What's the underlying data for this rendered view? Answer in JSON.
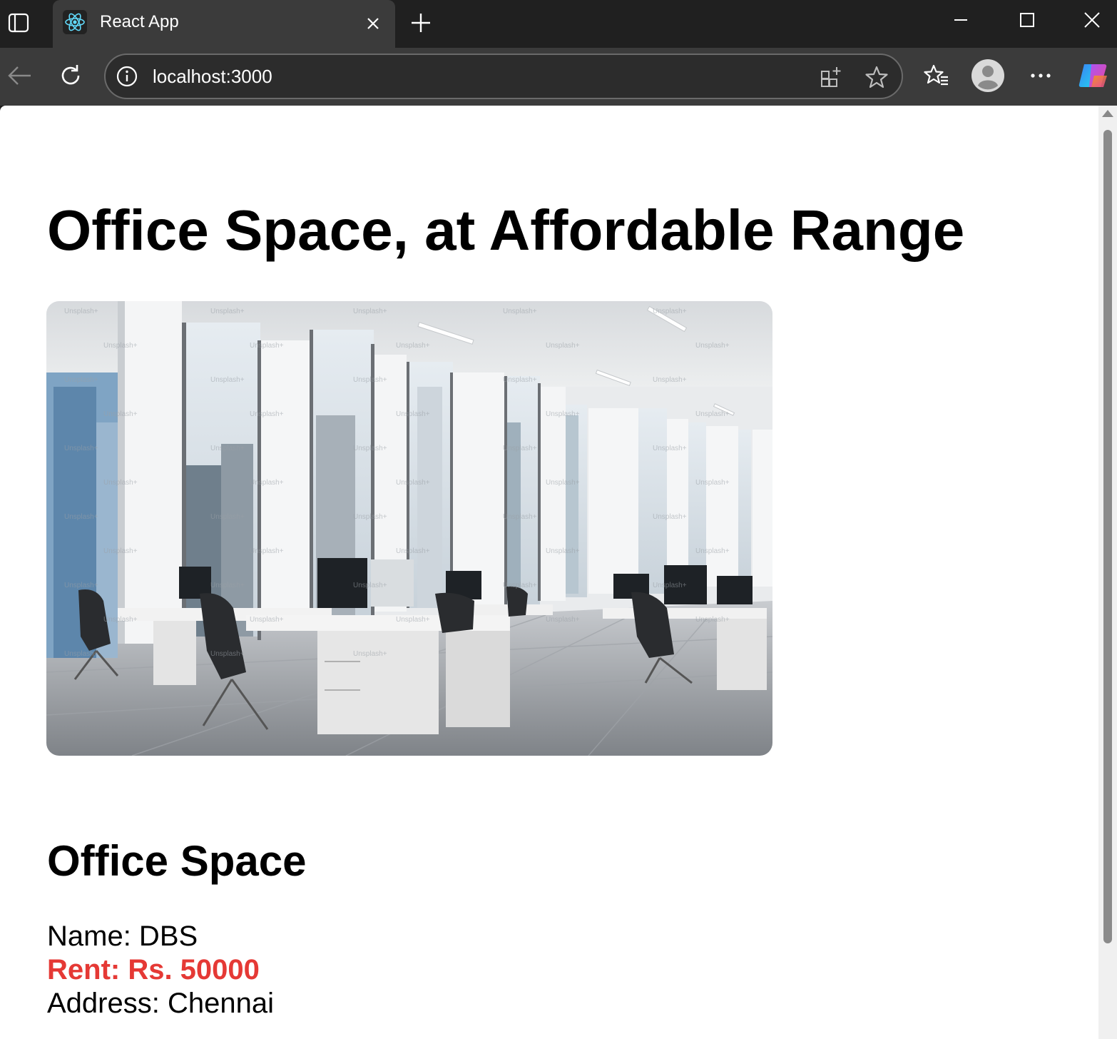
{
  "browser": {
    "tab_title": "React App",
    "address": "localhost:3000",
    "icons": {
      "sidebar": "sidebar-icon",
      "favicon": "react-logo-icon",
      "close": "close-icon",
      "new_tab": "plus-icon",
      "back": "back-arrow-icon",
      "refresh": "refresh-icon",
      "info": "info-icon",
      "apps": "add-app-icon",
      "favorite": "star-icon",
      "favorites": "favorites-icon",
      "profile": "profile-icon",
      "more": "more-icon",
      "copilot": "copilot-icon"
    }
  },
  "page": {
    "heading": "Office Space, at Affordable Range",
    "image_alt": "Office space",
    "section_heading": "Office Space",
    "details": {
      "name": "Name: DBS",
      "rent": "Rent: Rs. 50000",
      "address": "Address: Chennai"
    },
    "colors": {
      "rent": "#e53935"
    }
  }
}
